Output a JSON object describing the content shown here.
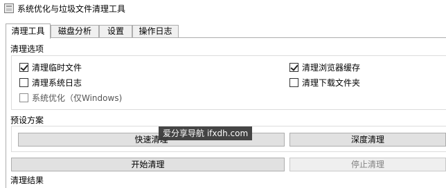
{
  "window": {
    "title": "系统优化与垃圾文件清理工具"
  },
  "tabs": [
    "清理工具",
    "磁盘分析",
    "设置",
    "操作日志"
  ],
  "cleanup_options": {
    "label": "清理选项",
    "items": [
      {
        "label": "清理临时文件",
        "checked": true
      },
      {
        "label": "清理浏览器缓存",
        "checked": true
      },
      {
        "label": "清理系统日志",
        "checked": false
      },
      {
        "label": "清理下载文件夹",
        "checked": false
      },
      {
        "label": "系统优化（仅Windows)",
        "checked": false
      }
    ]
  },
  "presets": {
    "label": "预设方案",
    "quick_label": "快速清理",
    "deep_label": "深度清理"
  },
  "actions": {
    "start_label": "开始清理",
    "stop_label": "停止清理"
  },
  "results": {
    "label": "清理结果"
  },
  "watermark": "爱分享导航 ifxdh.com"
}
